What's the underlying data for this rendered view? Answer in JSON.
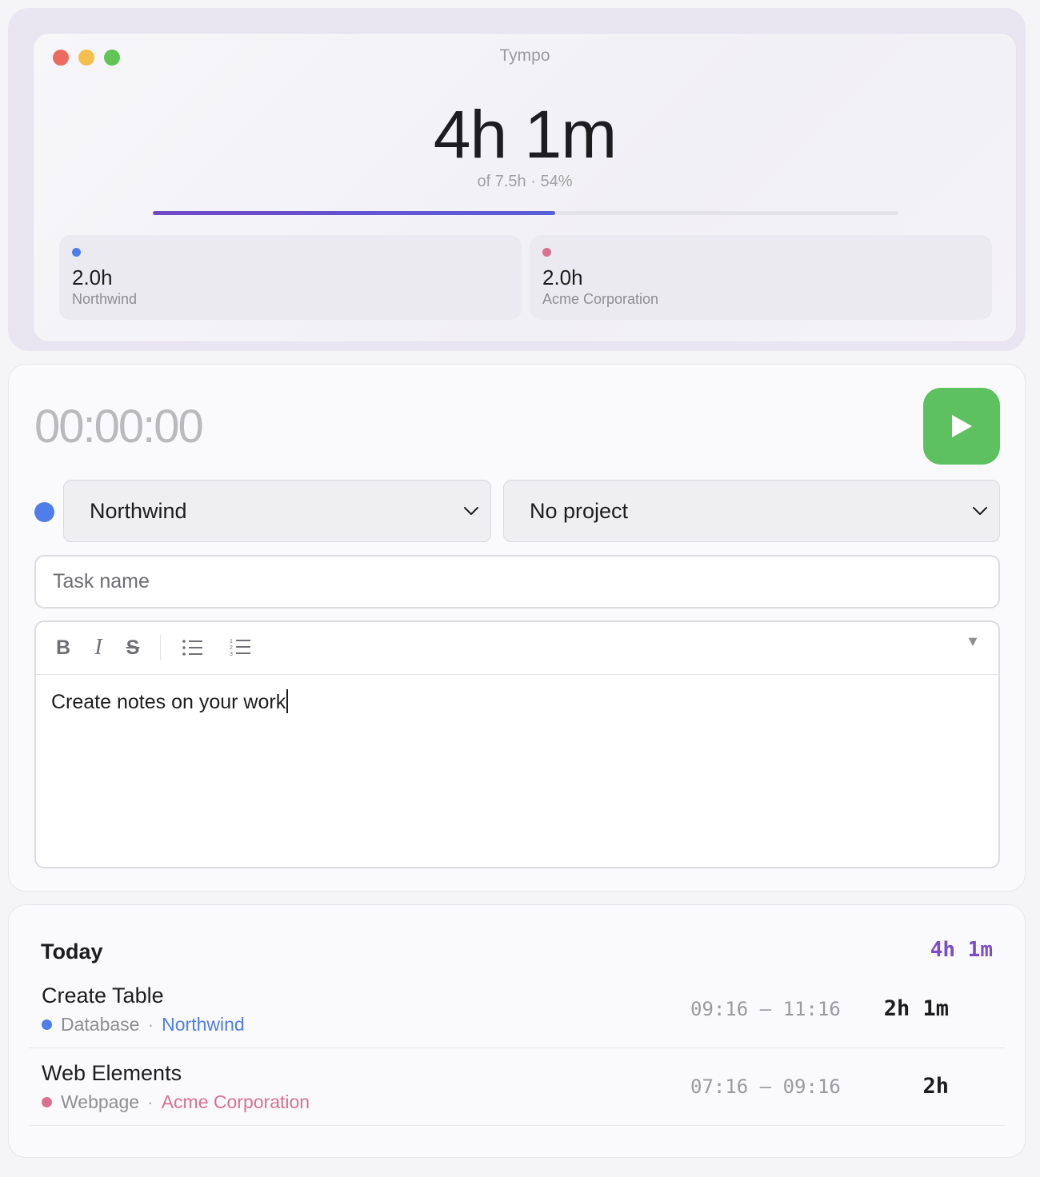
{
  "app": {
    "title": "Tympo"
  },
  "summary": {
    "total": "4h 1m",
    "goal_text": "of 7.5h · 54%",
    "progress_percent": 54,
    "clients": [
      {
        "hours": "2.0h",
        "name": "Northwind",
        "color": "#4f7de9"
      },
      {
        "hours": "2.0h",
        "name": "Acme Corporation",
        "color": "#d9708f"
      }
    ]
  },
  "timer": {
    "clock": "00:00:00",
    "play_icon": "play-icon",
    "client_color": "#4f7de9",
    "client_select": "Northwind",
    "project_select": "No project",
    "task_placeholder": "Task name",
    "toolbar": {
      "bold": "B",
      "italic": "I",
      "strike": "S",
      "collapse": "▼"
    },
    "notes_text": "Create notes on your work"
  },
  "today": {
    "title": "Today",
    "total": "4h 1m",
    "accent": "#7a4fc4",
    "entries": [
      {
        "name": "Create Table",
        "project": "Database",
        "client": "Northwind",
        "client_color": "#4f7de9",
        "range": "09:16 — 11:16",
        "duration": "2h 1m"
      },
      {
        "name": "Web Elements",
        "project": "Webpage",
        "client": "Acme Corporation",
        "client_color": "#d9708f",
        "range": "07:16 — 09:16",
        "duration": "2h"
      }
    ]
  }
}
